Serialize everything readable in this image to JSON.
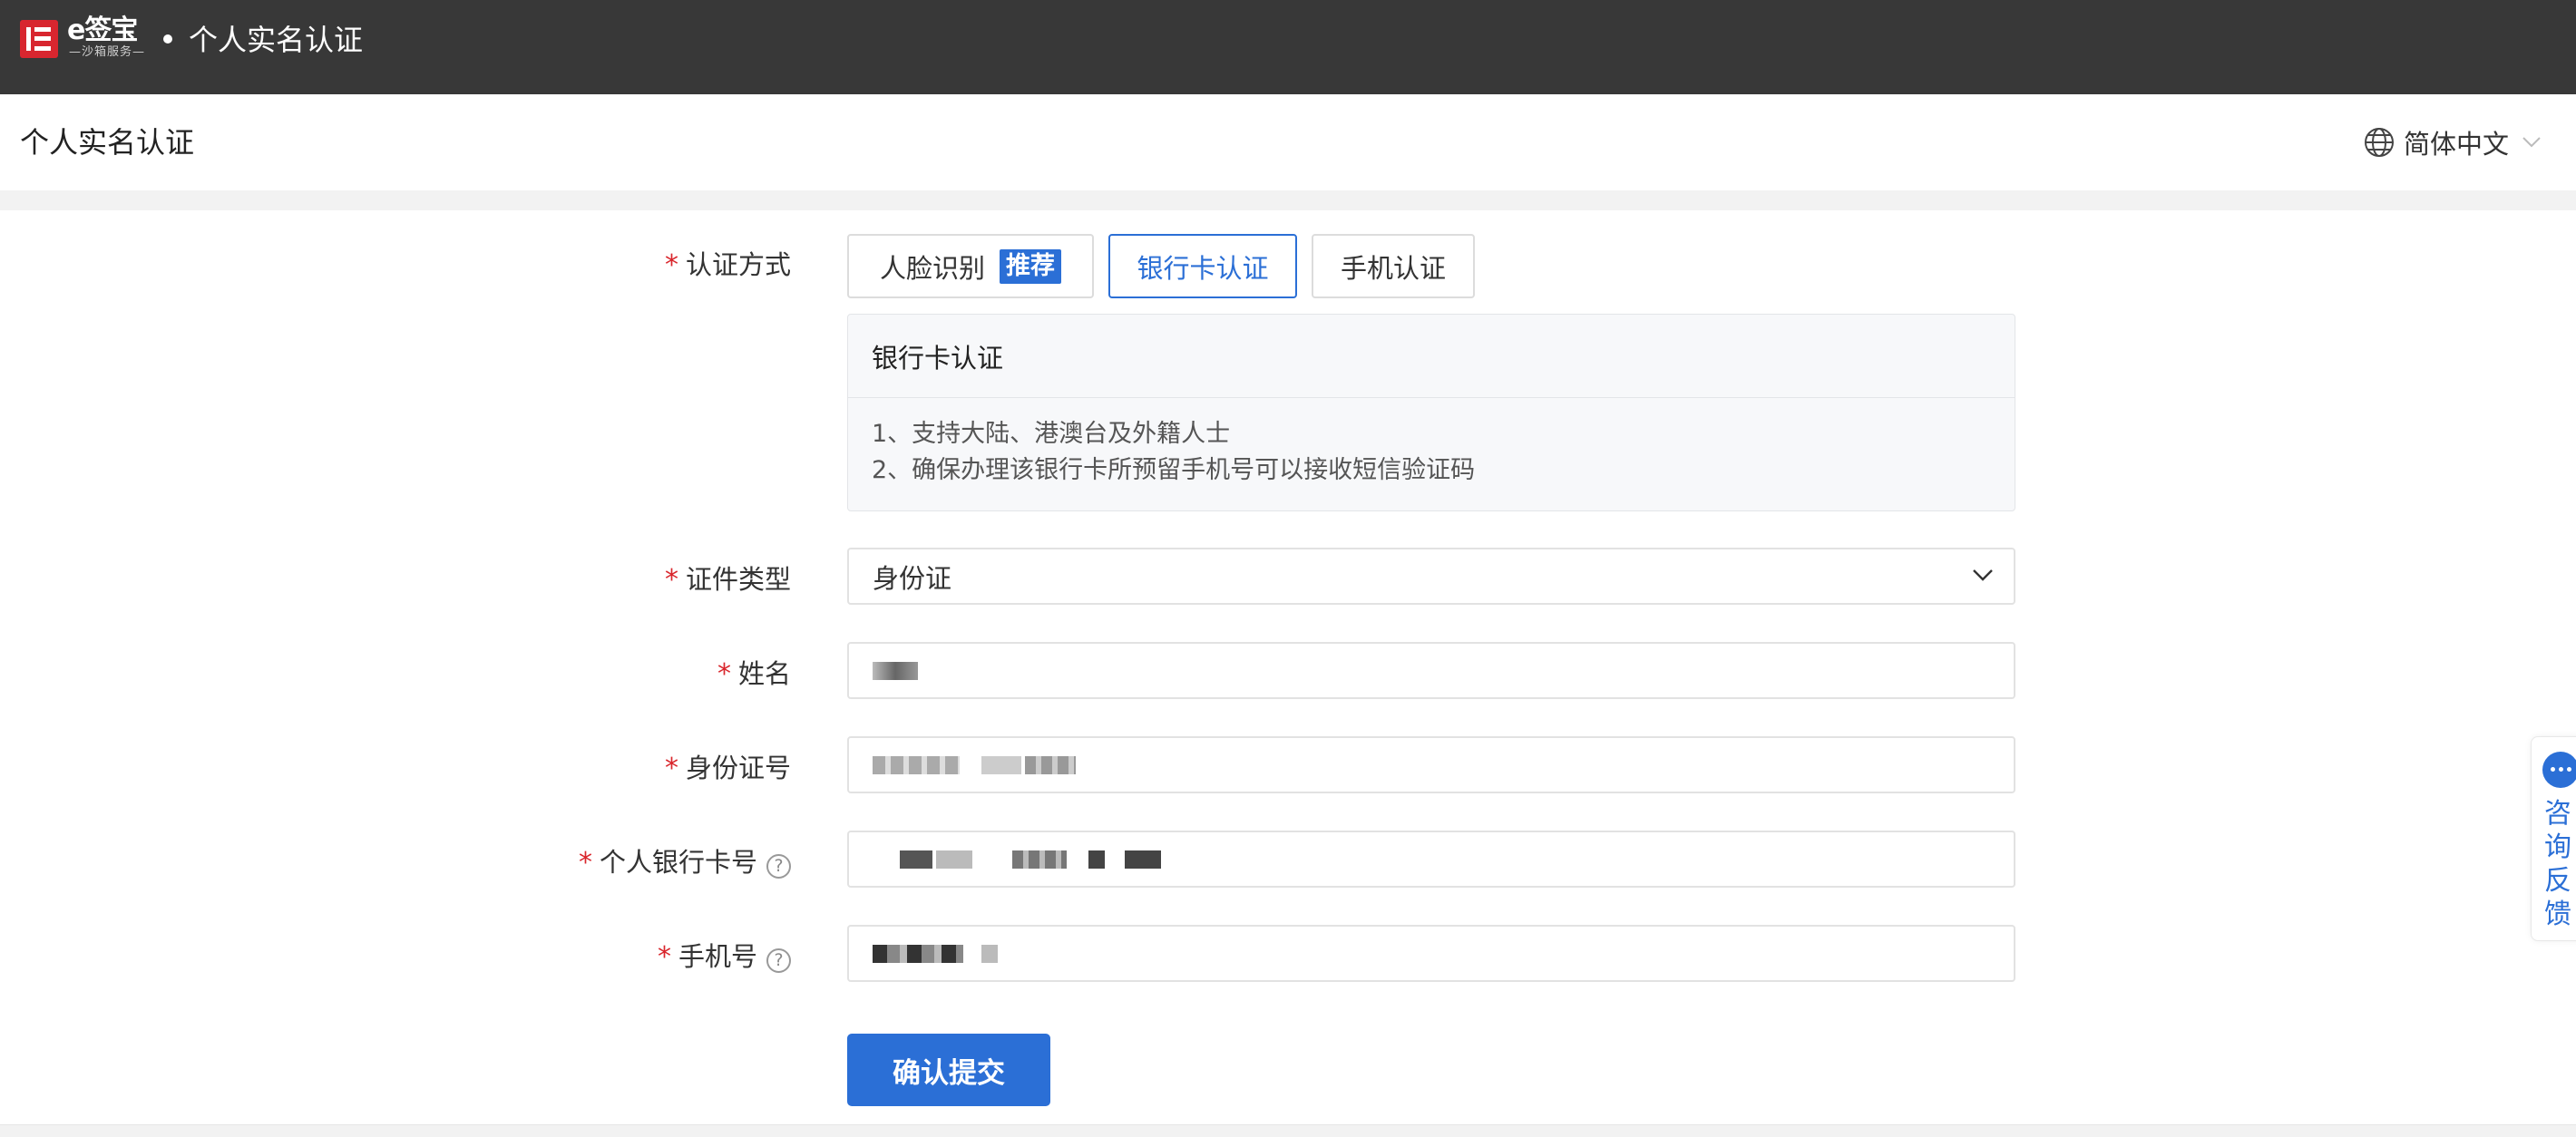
{
  "topbar": {
    "logo_text": "e签宝",
    "logo_sub": "—沙箱服务—",
    "title": "个人实名认证"
  },
  "subheader": {
    "title": "个人实名认证",
    "language": "简体中文"
  },
  "form": {
    "method": {
      "label": "认证方式",
      "options": [
        {
          "label": "人脸识别",
          "tag": "推荐"
        },
        {
          "label": "银行卡认证"
        },
        {
          "label": "手机认证"
        }
      ],
      "selected": "银行卡认证"
    },
    "info": {
      "title": "银行卡认证",
      "lines": [
        "1、支持大陆、港澳台及外籍人士",
        "2、确保办理该银行卡所预留手机号可以接收短信验证码"
      ]
    },
    "id_type": {
      "label": "证件类型",
      "value": "身份证"
    },
    "name": {
      "label": "姓名"
    },
    "id_number": {
      "label": "身份证号"
    },
    "bank_card": {
      "label": "个人银行卡号"
    },
    "phone": {
      "label": "手机号"
    },
    "submit_label": "确认提交"
  },
  "side_feedback": {
    "label": "咨询反馈"
  },
  "colors": {
    "primary": "#2b6fd6",
    "topbar": "#383838",
    "required": "#d9262c"
  }
}
